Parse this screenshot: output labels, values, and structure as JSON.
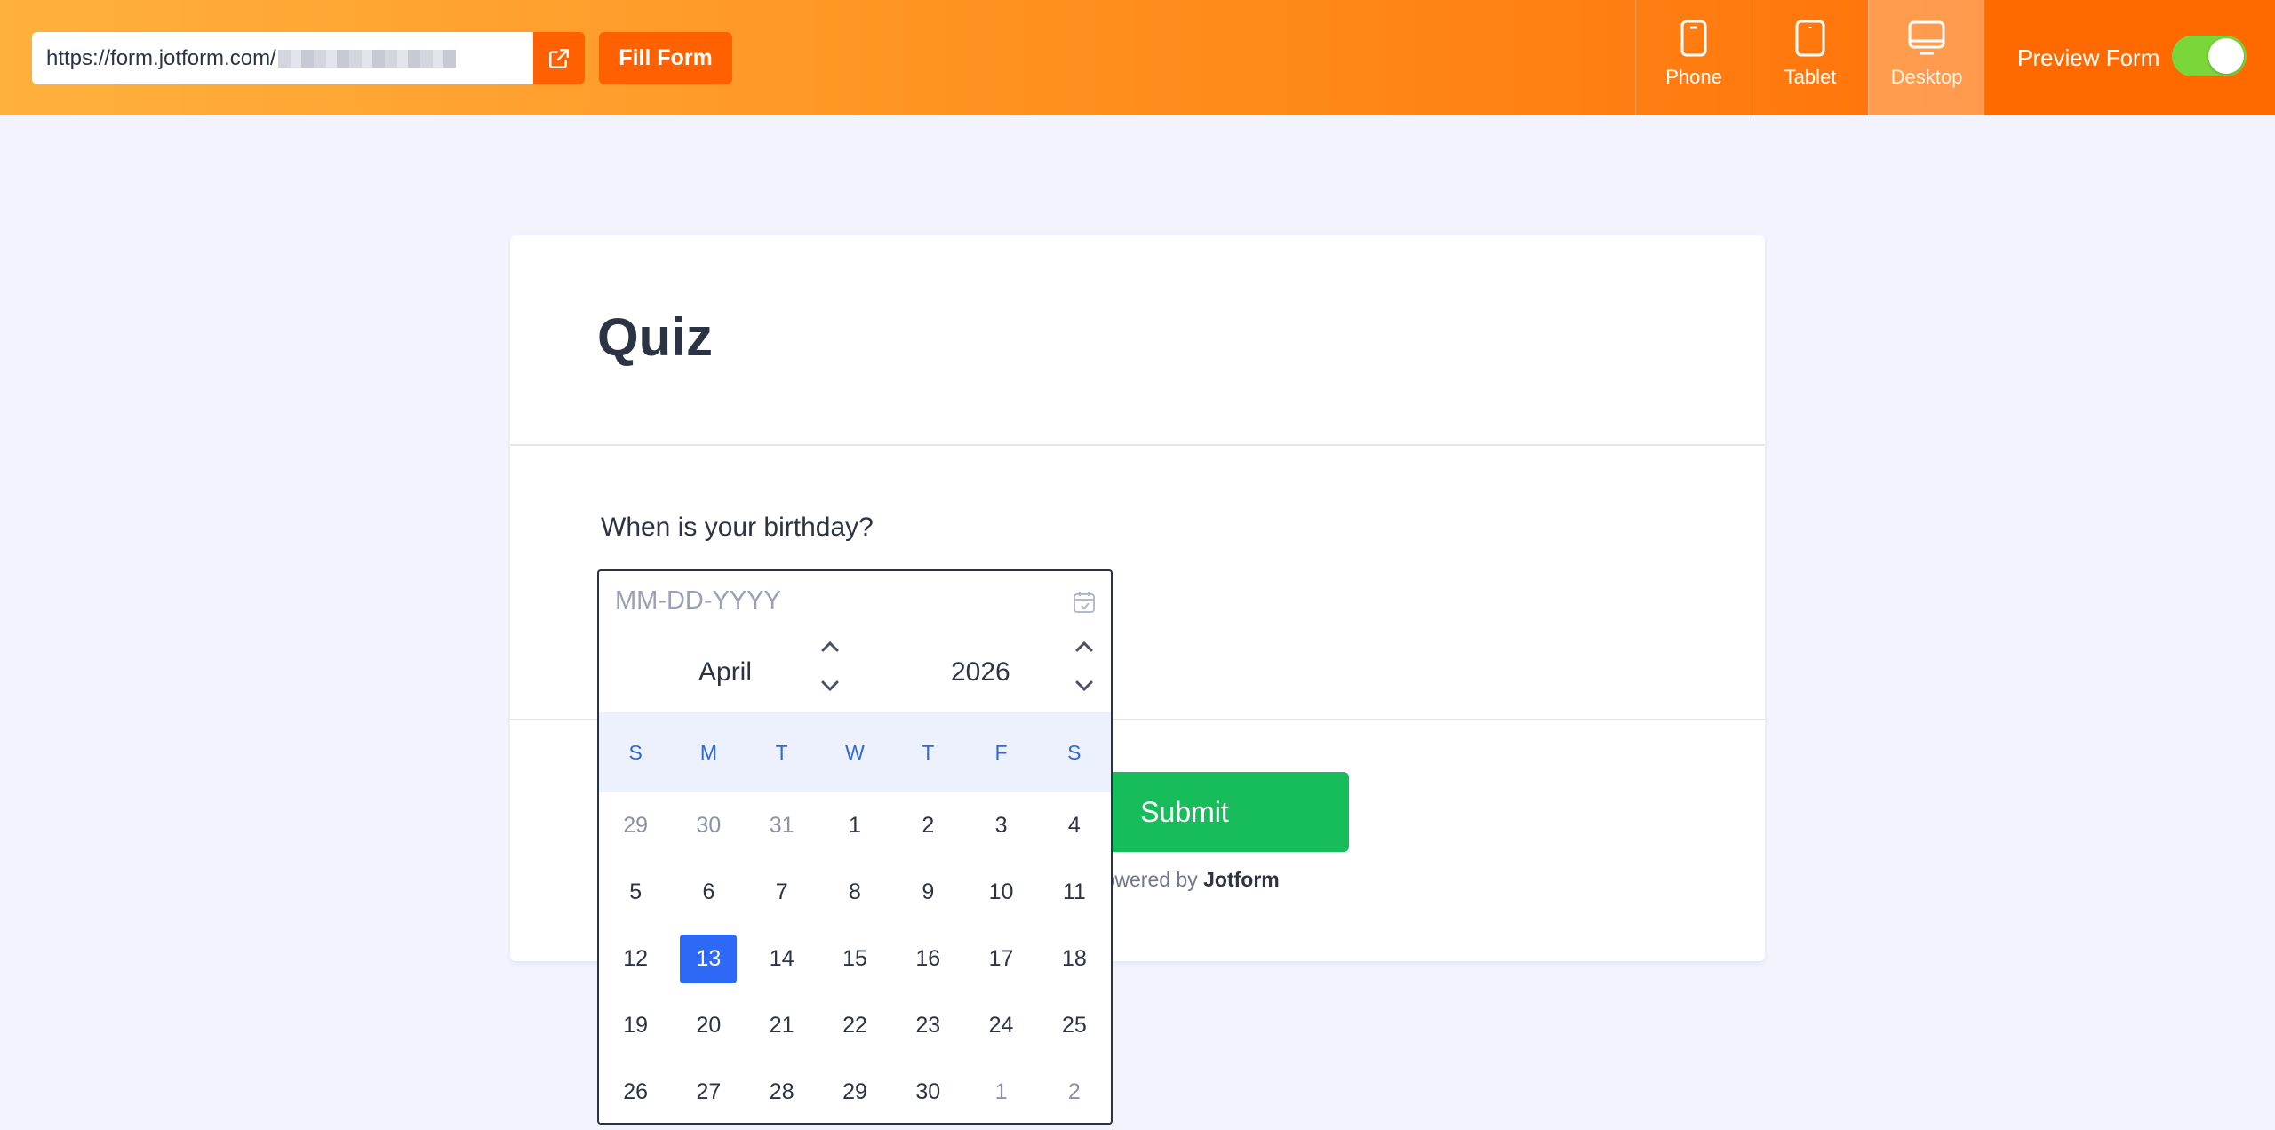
{
  "topbar": {
    "url": "https://form.jotform.com/",
    "fill_form_label": "Fill Form",
    "devices": [
      {
        "label": "Phone",
        "icon": "phone-icon",
        "active": false
      },
      {
        "label": "Tablet",
        "icon": "tablet-icon",
        "active": false
      },
      {
        "label": "Desktop",
        "icon": "desktop-icon",
        "active": true
      }
    ],
    "preview_label": "Preview Form",
    "preview_on": true
  },
  "form": {
    "title": "Quiz",
    "question": "When is your birthday?",
    "date_placeholder": "MM-DD-YYYY",
    "submit_label": "Submit",
    "powered_prefix": "Powered by",
    "powered_brand": "Jotform"
  },
  "calendar": {
    "month": "April",
    "year": "2026",
    "weekdays": [
      "S",
      "M",
      "T",
      "W",
      "T",
      "F",
      "S"
    ],
    "days": [
      {
        "d": "29",
        "muted": true
      },
      {
        "d": "30",
        "muted": true
      },
      {
        "d": "31",
        "muted": true
      },
      {
        "d": "1"
      },
      {
        "d": "2"
      },
      {
        "d": "3"
      },
      {
        "d": "4"
      },
      {
        "d": "5"
      },
      {
        "d": "6"
      },
      {
        "d": "7"
      },
      {
        "d": "8"
      },
      {
        "d": "9"
      },
      {
        "d": "10"
      },
      {
        "d": "11"
      },
      {
        "d": "12"
      },
      {
        "d": "13",
        "selected": true
      },
      {
        "d": "14"
      },
      {
        "d": "15"
      },
      {
        "d": "16"
      },
      {
        "d": "17"
      },
      {
        "d": "18"
      },
      {
        "d": "19"
      },
      {
        "d": "20"
      },
      {
        "d": "21"
      },
      {
        "d": "22"
      },
      {
        "d": "23"
      },
      {
        "d": "24"
      },
      {
        "d": "25"
      },
      {
        "d": "26"
      },
      {
        "d": "27"
      },
      {
        "d": "28"
      },
      {
        "d": "29"
      },
      {
        "d": "30"
      },
      {
        "d": "1",
        "muted": true
      },
      {
        "d": "2",
        "muted": true
      }
    ]
  },
  "colors": {
    "accent": "#ff6100",
    "submit": "#18bd5b",
    "selected_day": "#2e69f5",
    "toggle_on": "#7bd63a"
  }
}
